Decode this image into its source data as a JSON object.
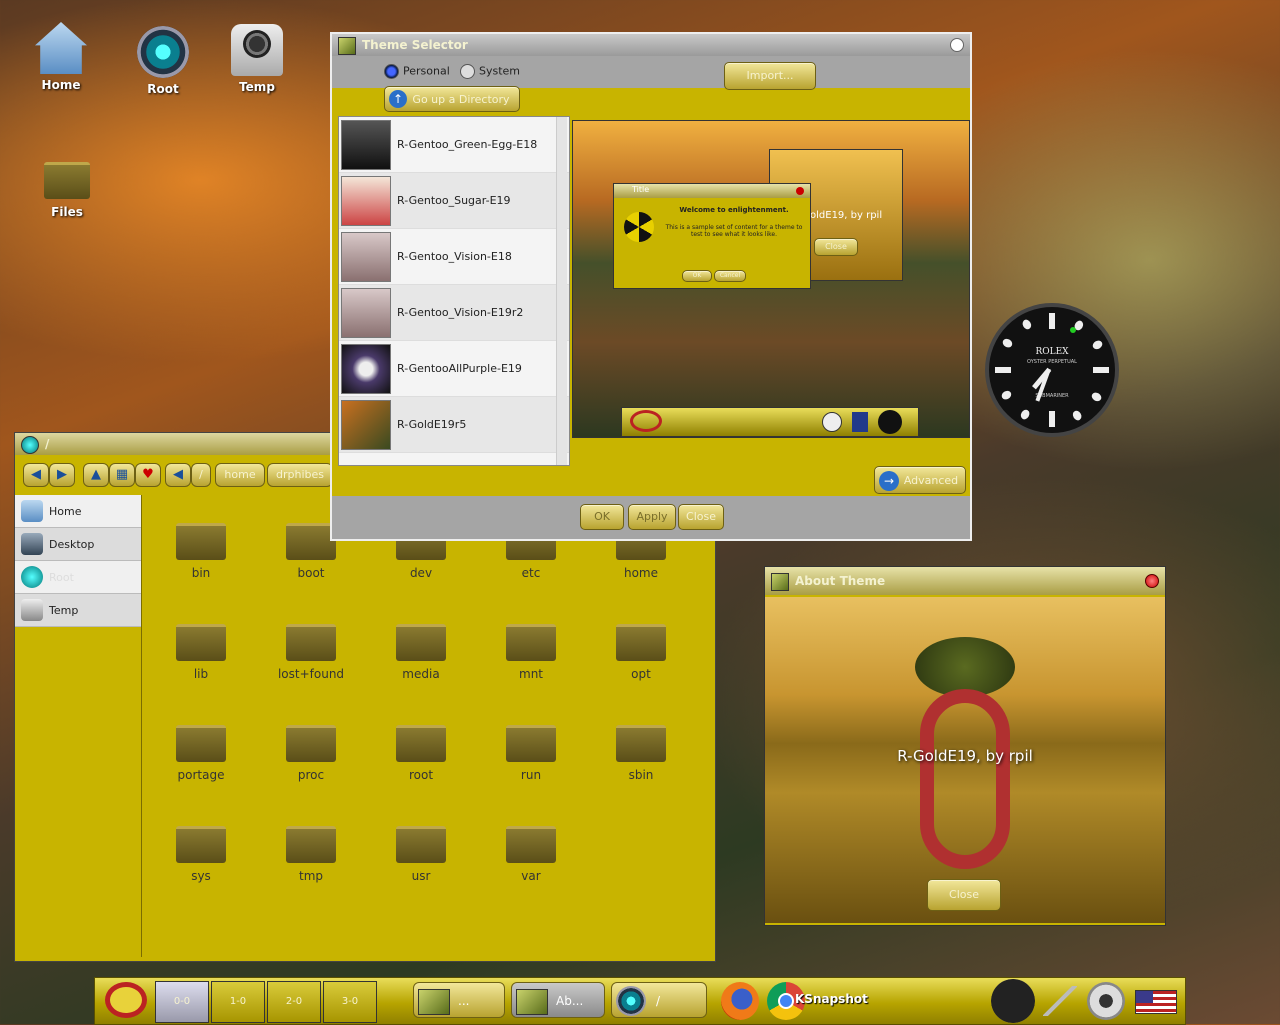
{
  "desktop": {
    "icons": [
      {
        "label": "Home"
      },
      {
        "label": "Root"
      },
      {
        "label": "Temp"
      },
      {
        "label": "Files"
      }
    ]
  },
  "theme_selector": {
    "title": "Theme Selector",
    "radio_personal": "Personal",
    "radio_system": "System",
    "import_label": "Import...",
    "go_up_label": "Go up a Directory",
    "themes": [
      "R-Gentoo_Green-Egg-E18",
      "R-Gentoo_Sugar-E19",
      "R-Gentoo_Vision-E18",
      "R-Gentoo_Vision-E19r2",
      "R-GentooAllPurple-E19",
      "R-GoldE19r5"
    ],
    "preview": {
      "dialog_title": "Title",
      "dialog_heading": "Welcome to enlightenment.",
      "dialog_body": "This is a sample set of content for a theme to test to see what it looks like.",
      "dialog_ok": "OK",
      "dialog_cancel": "Cancel",
      "bg_window_text": "oldE19, by rpil",
      "bg_window_button": "Close"
    },
    "advanced_label": "Advanced",
    "ok_label": "OK",
    "apply_label": "Apply",
    "close_label": "Close"
  },
  "file_manager": {
    "title": "/",
    "breadcrumbs": [
      "/",
      "home",
      "drphibes"
    ],
    "places": [
      "Home",
      "Desktop",
      "Root",
      "Temp"
    ],
    "folders": [
      "bin",
      "boot",
      "dev",
      "etc",
      "home",
      "lib",
      "lost+found",
      "media",
      "mnt",
      "opt",
      "portage",
      "proc",
      "root",
      "run",
      "sbin",
      "sys",
      "tmp",
      "usr",
      "var"
    ]
  },
  "about_theme": {
    "title": "About Theme",
    "caption": "R-GoldE19, by rpil",
    "close_label": "Close"
  },
  "clock": {
    "brand": "ROLEX",
    "line1": "OYSTER PERPETUAL",
    "line2": "SUBMARINER"
  },
  "taskbar": {
    "desks": [
      "0-0",
      "1-0",
      "2-0",
      "3-0"
    ],
    "tasks": [
      {
        "label": "..."
      },
      {
        "label": "Ab..."
      },
      {
        "label": "/"
      }
    ],
    "ksnapshot_label": "KSnapshot"
  },
  "colors": {
    "theme_gold": "#c8b400",
    "title_gradient_top": "#e7e2a8",
    "selected_radio": "#4466ff"
  }
}
